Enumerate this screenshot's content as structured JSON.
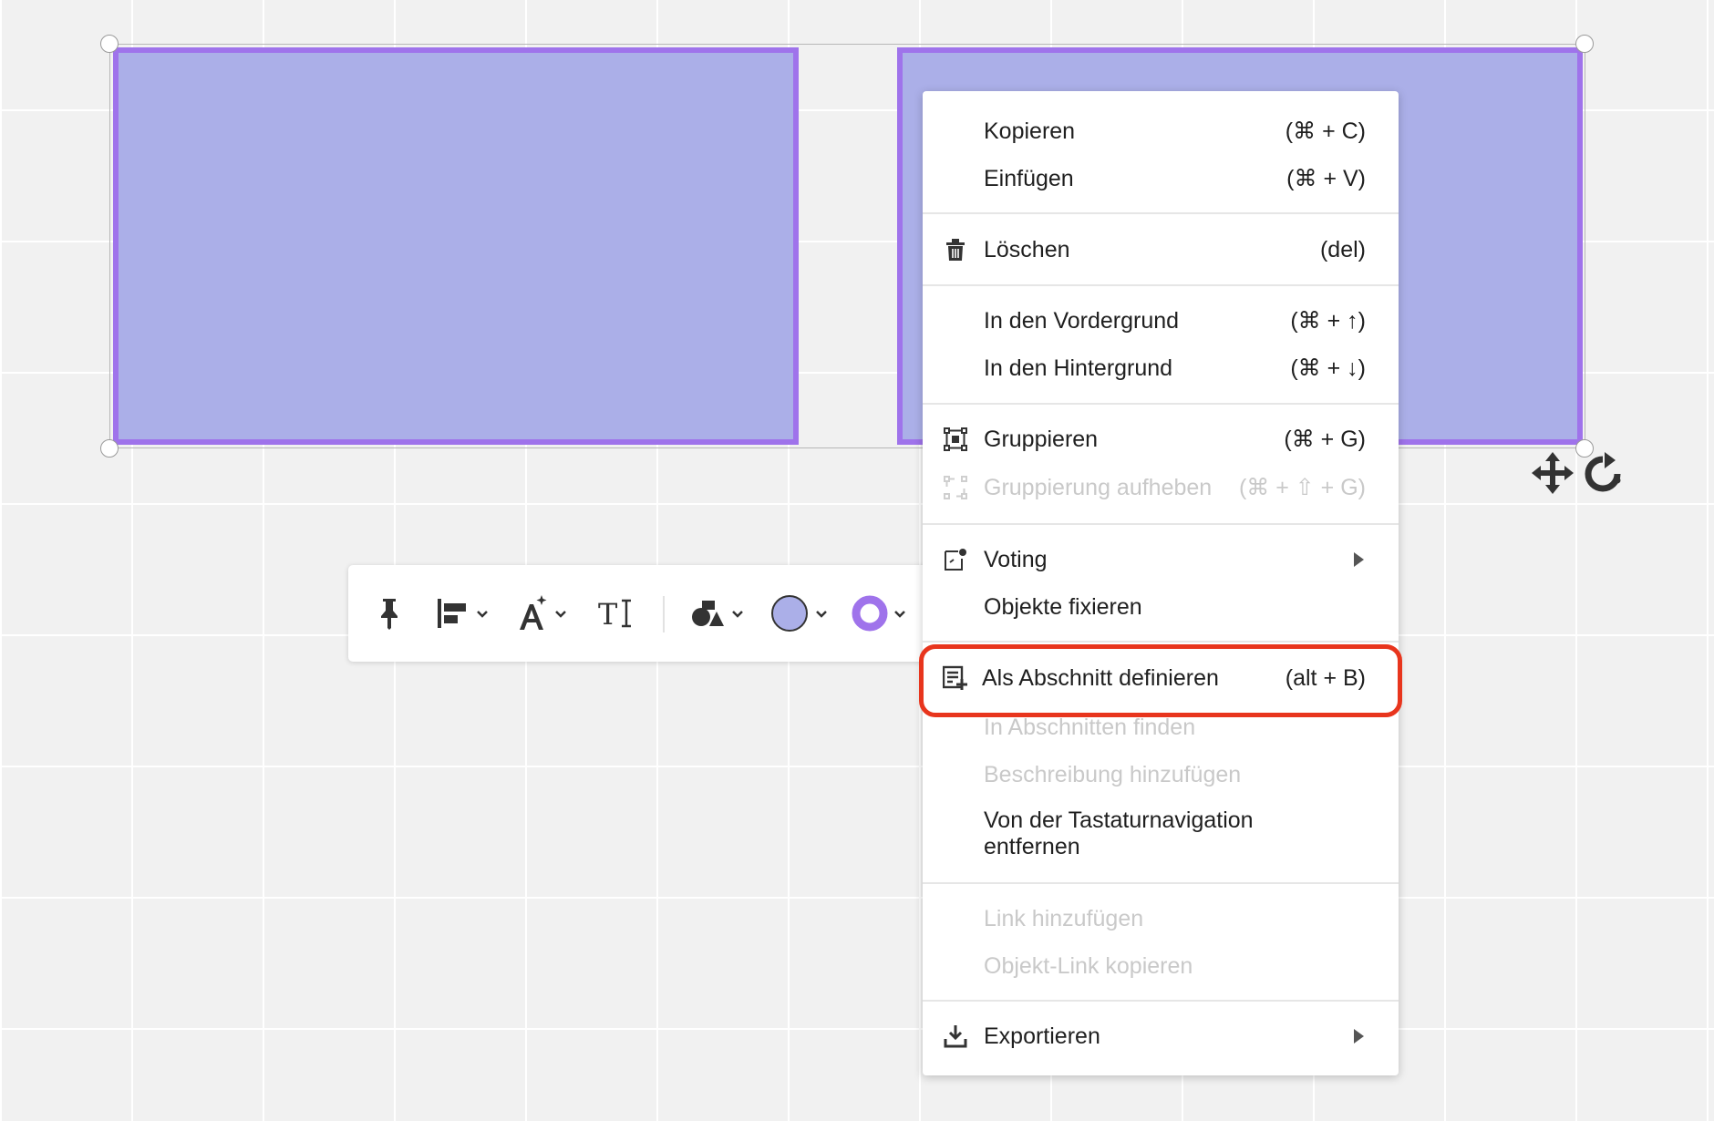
{
  "colors": {
    "shape_fill": "#abafe8",
    "shape_border": "#9f73eb",
    "highlight": "#e8351d",
    "disabled_text": "#c9c9c9"
  },
  "context_menu": {
    "items": [
      {
        "label": "Kopieren",
        "shortcut": "(⌘ + C)",
        "icon": null,
        "enabled": true
      },
      {
        "label": "Einfügen",
        "shortcut": "(⌘ + V)",
        "icon": null,
        "enabled": true
      },
      {
        "label": "Löschen",
        "shortcut": "(del)",
        "icon": "trash-icon",
        "enabled": true
      },
      {
        "label": "In den Vordergrund",
        "shortcut": "(⌘ + ↑)",
        "icon": null,
        "enabled": true
      },
      {
        "label": "In den Hintergrund",
        "shortcut": "(⌘ + ↓)",
        "icon": null,
        "enabled": true
      },
      {
        "label": "Gruppieren",
        "shortcut": "(⌘ + G)",
        "icon": "group-icon",
        "enabled": true
      },
      {
        "label": "Gruppierung aufheben",
        "shortcut": "(⌘ + ⇧ + G)",
        "icon": "ungroup-icon",
        "enabled": false
      },
      {
        "label": "Voting",
        "shortcut": "",
        "icon": "voting-icon",
        "enabled": true,
        "submenu": true
      },
      {
        "label": "Objekte fixieren",
        "shortcut": "",
        "icon": null,
        "enabled": true
      },
      {
        "label": "Als Abschnitt definieren",
        "shortcut": "(alt + B)",
        "icon": "add-section-icon",
        "enabled": true,
        "highlighted": true
      },
      {
        "label": "In Abschnitten finden",
        "shortcut": "",
        "icon": null,
        "enabled": false
      },
      {
        "label": "Beschreibung hinzufügen",
        "shortcut": "",
        "icon": null,
        "enabled": false
      },
      {
        "label": "Von der Tastaturnavigation entfernen",
        "shortcut": "",
        "icon": null,
        "enabled": true
      },
      {
        "label": "Link hinzufügen",
        "shortcut": "",
        "icon": null,
        "enabled": false
      },
      {
        "label": "Objekt-Link kopieren",
        "shortcut": "",
        "icon": null,
        "enabled": false
      },
      {
        "label": "Exportieren",
        "shortcut": "",
        "icon": "export-icon",
        "enabled": true,
        "submenu": true
      }
    ]
  },
  "toolbar": {
    "buttons": [
      {
        "name": "pin-button",
        "icon": "pin-icon"
      },
      {
        "name": "align-button",
        "icon": "align-left-icon",
        "dropdown": true
      },
      {
        "name": "text-style-button",
        "icon": "font-style-icon",
        "dropdown": true
      },
      {
        "name": "text-size-button",
        "icon": "text-size-icon",
        "label": "TI"
      },
      {
        "name": "shape-button",
        "icon": "shapes-icon",
        "dropdown": true
      },
      {
        "name": "fill-color-button",
        "icon": "fill-color-swatch",
        "dropdown": true,
        "color": "#abafe8"
      },
      {
        "name": "border-color-button",
        "icon": "border-color-swatch",
        "dropdown": true,
        "color": "#9f73eb"
      }
    ]
  }
}
